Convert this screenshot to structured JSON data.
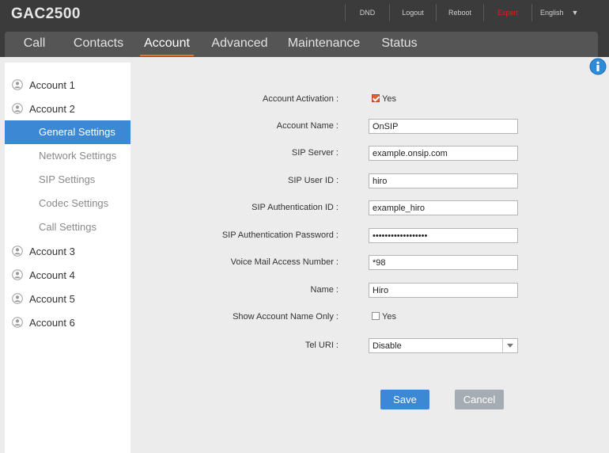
{
  "header": {
    "brand": "GAC2500",
    "links": [
      {
        "label": "DND"
      },
      {
        "label": "Logout"
      },
      {
        "label": "Reboot"
      },
      {
        "label": "Expert"
      }
    ],
    "language": "English",
    "expert_color": "#e0201c"
  },
  "nav": {
    "tabs": [
      {
        "label": "Call"
      },
      {
        "label": "Contacts"
      },
      {
        "label": "Account"
      },
      {
        "label": "Advanced"
      },
      {
        "label": "Maintenance"
      },
      {
        "label": "Status"
      }
    ],
    "active": "Account",
    "accent": "#e8702a"
  },
  "sidebar": {
    "accounts": [
      {
        "label": "Account 1"
      },
      {
        "label": "Account 2"
      },
      {
        "label": "Account 3"
      },
      {
        "label": "Account 4"
      },
      {
        "label": "Account 5"
      },
      {
        "label": "Account 6"
      }
    ],
    "subitems": [
      {
        "label": "General Settings"
      },
      {
        "label": "Network Settings"
      },
      {
        "label": "SIP Settings"
      },
      {
        "label": "Codec Settings"
      },
      {
        "label": "Call Settings"
      }
    ],
    "active": "General Settings",
    "active_color": "#3c88d4"
  },
  "form": {
    "account_activation": {
      "label": "Account Activation :",
      "checked": true,
      "option": "Yes"
    },
    "account_name": {
      "label": "Account Name :",
      "value": "OnSIP"
    },
    "sip_server": {
      "label": "SIP Server :",
      "value": "example.onsip.com"
    },
    "sip_user_id": {
      "label": "SIP User ID :",
      "value": "hiro"
    },
    "sip_auth_id": {
      "label": "SIP Authentication ID :",
      "value": "example_hiro"
    },
    "sip_auth_password": {
      "label": "SIP Authentication Password :",
      "value": "examplepassword123"
    },
    "voicemail_number": {
      "label": "Voice Mail Access Number :",
      "value": "*98"
    },
    "name": {
      "label": "Name :",
      "value": "Hiro"
    },
    "show_account_name_only": {
      "label": "Show Account Name Only :",
      "checked": false,
      "option": "Yes"
    },
    "tel_uri": {
      "label": "Tel URI :",
      "value": "Disable"
    }
  },
  "buttons": {
    "save": "Save",
    "cancel": "Cancel"
  },
  "icons": {
    "info": "info-icon",
    "account": "user-icon",
    "dropdown": "chevron-down-icon"
  }
}
